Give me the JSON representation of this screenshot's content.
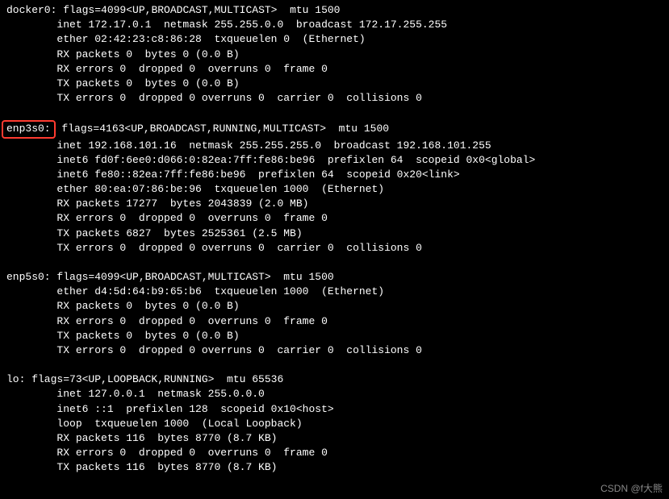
{
  "interfaces": [
    {
      "name": "docker0:",
      "highlighted": false,
      "header": " flags=4099<UP,BROADCAST,MULTICAST>  mtu 1500",
      "lines": [
        "        inet 172.17.0.1  netmask 255.255.0.0  broadcast 172.17.255.255",
        "        ether 02:42:23:c8:86:28  txqueuelen 0  (Ethernet)",
        "        RX packets 0  bytes 0 (0.0 B)",
        "        RX errors 0  dropped 0  overruns 0  frame 0",
        "        TX packets 0  bytes 0 (0.0 B)",
        "        TX errors 0  dropped 0 overruns 0  carrier 0  collisions 0"
      ]
    },
    {
      "name": "enp3s0:",
      "highlighted": true,
      "header": " flags=4163<UP,BROADCAST,RUNNING,MULTICAST>  mtu 1500",
      "lines": [
        "        inet 192.168.101.16  netmask 255.255.255.0  broadcast 192.168.101.255",
        "        inet6 fd0f:6ee0:d066:0:82ea:7ff:fe86:be96  prefixlen 64  scopeid 0x0<global>",
        "        inet6 fe80::82ea:7ff:fe86:be96  prefixlen 64  scopeid 0x20<link>",
        "        ether 80:ea:07:86:be:96  txqueuelen 1000  (Ethernet)",
        "        RX packets 17277  bytes 2043839 (2.0 MB)",
        "        RX errors 0  dropped 0  overruns 0  frame 0",
        "        TX packets 6827  bytes 2525361 (2.5 MB)",
        "        TX errors 0  dropped 0 overruns 0  carrier 0  collisions 0"
      ]
    },
    {
      "name": "enp5s0:",
      "highlighted": false,
      "header": " flags=4099<UP,BROADCAST,MULTICAST>  mtu 1500",
      "lines": [
        "        ether d4:5d:64:b9:65:b6  txqueuelen 1000  (Ethernet)",
        "        RX packets 0  bytes 0 (0.0 B)",
        "        RX errors 0  dropped 0  overruns 0  frame 0",
        "        TX packets 0  bytes 0 (0.0 B)",
        "        TX errors 0  dropped 0 overruns 0  carrier 0  collisions 0"
      ]
    },
    {
      "name": "lo:",
      "highlighted": false,
      "header": " flags=73<UP,LOOPBACK,RUNNING>  mtu 65536",
      "lines": [
        "        inet 127.0.0.1  netmask 255.0.0.0",
        "        inet6 ::1  prefixlen 128  scopeid 0x10<host>",
        "        loop  txqueuelen 1000  (Local Loopback)",
        "        RX packets 116  bytes 8770 (8.7 KB)",
        "        RX errors 0  dropped 0  overruns 0  frame 0",
        "        TX packets 116  bytes 8770 (8.7 KB)"
      ]
    }
  ],
  "watermark": "CSDN @f大熊"
}
